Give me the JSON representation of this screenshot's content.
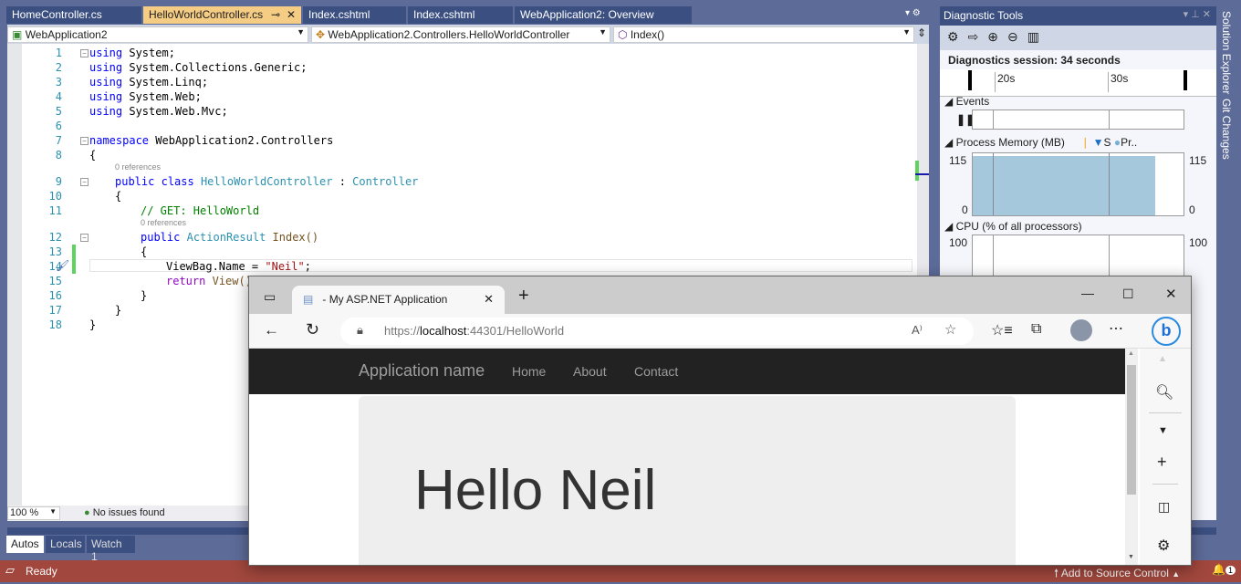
{
  "tabs": [
    "HomeController.cs",
    "HelloWorldController.cs",
    "Index.cshtml",
    "Index.cshtml",
    "WebApplication2: Overview"
  ],
  "nav": {
    "project": "WebApplication2",
    "class": "WebApplication2.Controllers.HelloWorldController",
    "member": "Index()"
  },
  "code": {
    "line_numbers": [
      "1",
      "2",
      "3",
      "4",
      "5",
      "6",
      "7",
      "8",
      "9",
      "10",
      "11",
      "12",
      "13",
      "14",
      "15",
      "16",
      "17",
      "18"
    ],
    "using": "using",
    "usings": [
      "System;",
      "System.Collections.Generic;",
      "System.Linq;",
      "System.Web;",
      "System.Web.Mvc;"
    ],
    "namespace_kw": "namespace",
    "namespace_name": "WebApplication2.Controllers",
    "lens": "0 references",
    "public": "public",
    "class_kw": "class",
    "class_name": "HelloWorldController",
    "colon": ":",
    "base": "Controller",
    "comment": "// GET: HelloWorld",
    "return_type": "ActionResult",
    "method": "Index()",
    "assign": "ViewBag.Name = ",
    "string": "\"Neil\"",
    "semi": ";",
    "return_kw": "return",
    "view": "View()",
    "open": "{",
    "close": "}"
  },
  "editor_status": {
    "zoom": "100 %",
    "issues": "No issues found"
  },
  "bottom_tabs": [
    "Autos",
    "Locals",
    "Watch 1"
  ],
  "statusbar": {
    "ready": "Ready",
    "source_control": "Add to Source Control",
    "notifications": "1"
  },
  "diagnostics": {
    "title": "Diagnostic Tools",
    "session": "Diagnostics session: 34 seconds",
    "ticks": [
      "20s",
      "30s"
    ],
    "events": "Events",
    "memory": {
      "label": "Process Memory (MB)",
      "legend_s": "S",
      "legend_p": "Pr..",
      "max": "115",
      "min": "0",
      "value_fraction": 0.96
    },
    "cpu": {
      "label": "CPU (% of all processors)",
      "max": "100"
    }
  },
  "side_tabs": [
    "Solution Explorer",
    "Git Changes"
  ],
  "browser": {
    "tab_title": "- My ASP.NET Application",
    "url_scheme": "https://",
    "url_host": "localhost",
    "url_rest": ":44301/HelloWorld",
    "app_name": "Application name",
    "links": [
      "Home",
      "About",
      "Contact"
    ],
    "heading": "Hello Neil"
  }
}
